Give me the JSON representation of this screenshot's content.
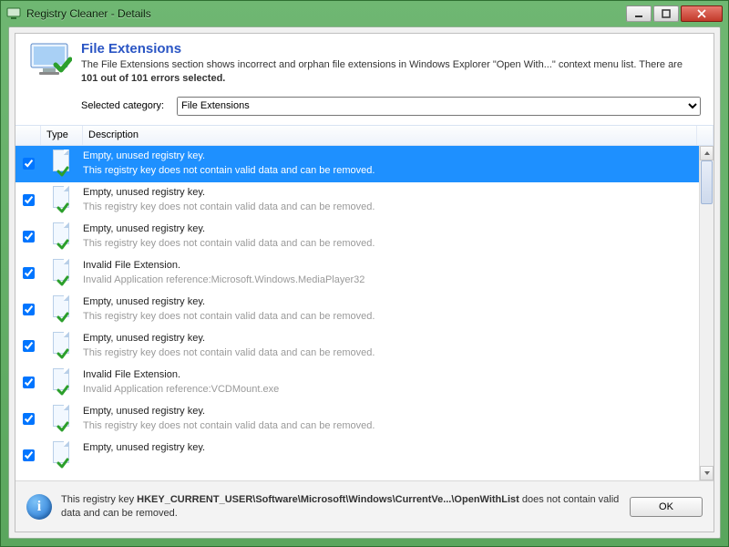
{
  "window": {
    "title": "Registry Cleaner - Details"
  },
  "header": {
    "title": "File Extensions",
    "desc_pre": "The File Extensions section shows incorrect and orphan file extensions in Windows Explorer \"Open With...\" context menu list. There are ",
    "desc_bold": "101 out of 101 errors selected.",
    "category_label": "Selected category:",
    "category_value": "File Extensions"
  },
  "columns": {
    "type": "Type",
    "description": "Description"
  },
  "rows": [
    {
      "checked": true,
      "selected": true,
      "title": "Empty, unused registry key.",
      "detail": "This registry key does not contain valid data and can be removed."
    },
    {
      "checked": true,
      "selected": false,
      "title": "Empty, unused registry key.",
      "detail": "This registry key does not contain valid data and can be removed."
    },
    {
      "checked": true,
      "selected": false,
      "title": "Empty, unused registry key.",
      "detail": "This registry key does not contain valid data and can be removed."
    },
    {
      "checked": true,
      "selected": false,
      "title": "Invalid File Extension.",
      "detail": "Invalid Application reference:Microsoft.Windows.MediaPlayer32"
    },
    {
      "checked": true,
      "selected": false,
      "title": "Empty, unused registry key.",
      "detail": "This registry key does not contain valid data and can be removed."
    },
    {
      "checked": true,
      "selected": false,
      "title": "Empty, unused registry key.",
      "detail": "This registry key does not contain valid data and can be removed."
    },
    {
      "checked": true,
      "selected": false,
      "title": "Invalid File Extension.",
      "detail": "Invalid Application reference:VCDMount.exe"
    },
    {
      "checked": true,
      "selected": false,
      "title": "Empty, unused registry key.",
      "detail": "This registry key does not contain valid data and can be removed."
    },
    {
      "checked": true,
      "selected": false,
      "title": "Empty, unused registry key.",
      "detail": ""
    }
  ],
  "footer": {
    "pre": "This registry key ",
    "bold": "HKEY_CURRENT_USER\\Software\\Microsoft\\Windows\\CurrentVe...\\OpenWithList",
    "post": " does not contain valid data and can be removed.",
    "ok": "OK"
  }
}
